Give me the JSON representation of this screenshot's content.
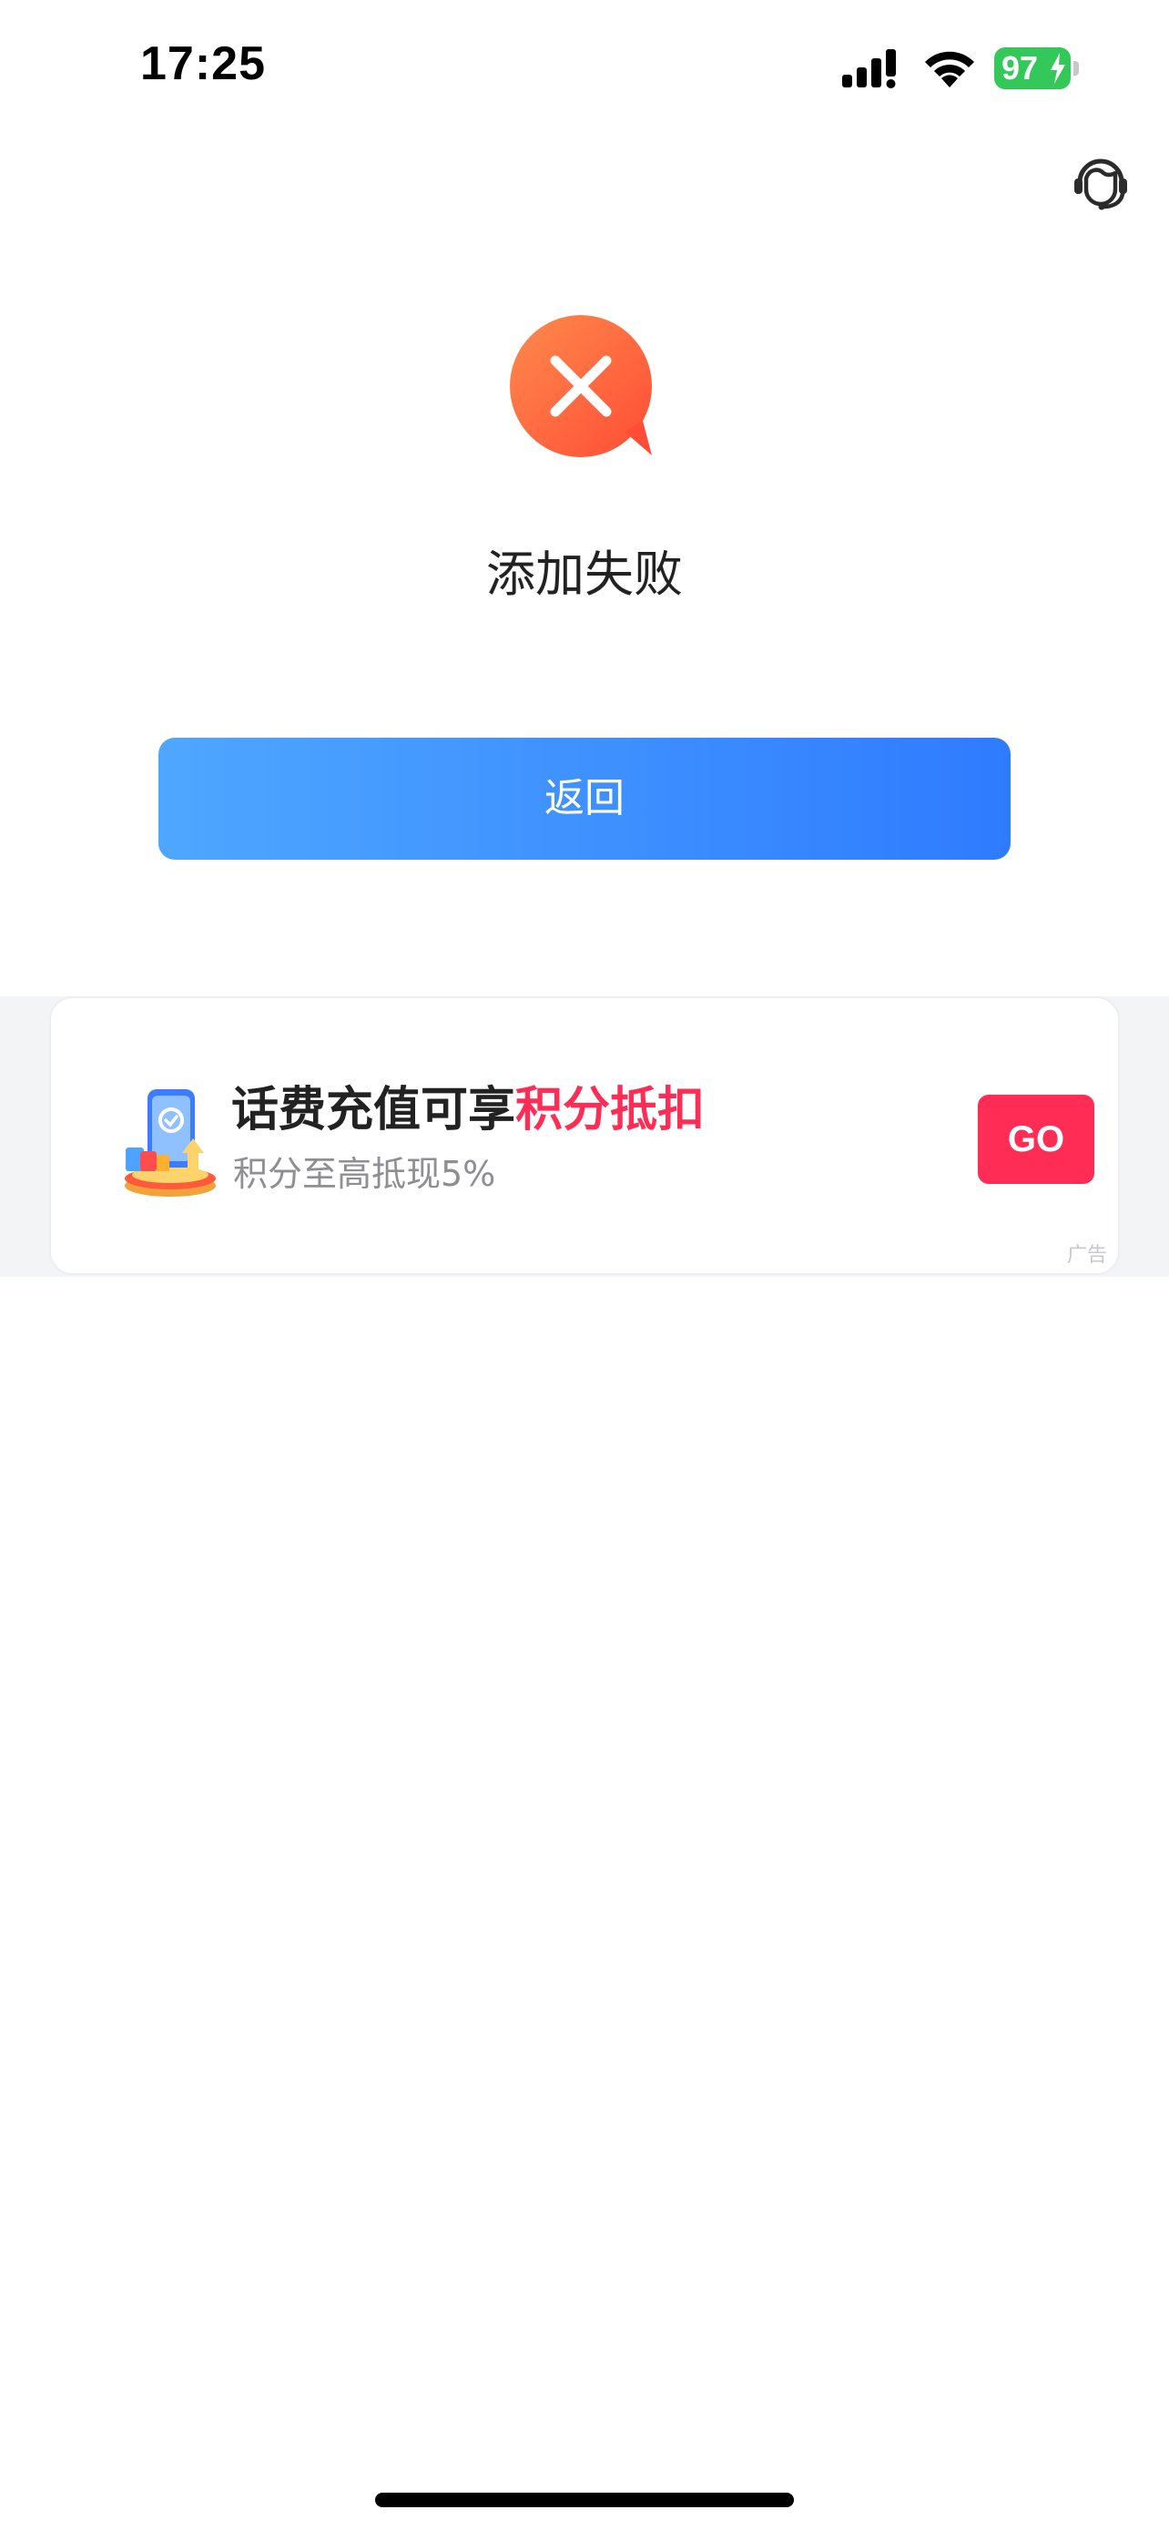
{
  "status_bar": {
    "time": "17:25",
    "battery_level": "97",
    "icons": [
      "signal-icon",
      "wifi-icon",
      "battery-icon",
      "charging-bolt-icon"
    ]
  },
  "header": {
    "service_icon": "customer-service-icon"
  },
  "result": {
    "icon": "error-x-icon",
    "title": "添加失败",
    "back_label": "返回"
  },
  "ad": {
    "image_icon": "phone-recharge-promo-icon",
    "title_prefix": "话费充值可享",
    "title_highlight": "积分抵扣",
    "subtitle": "积分至高抵现5%",
    "cta": "GO",
    "badge": "广告"
  },
  "colors": {
    "accent_blue_start": "#4fa7ff",
    "accent_blue_end": "#2f7bff",
    "promo_red": "#ff2d55",
    "error_orange": "#ff6a3d",
    "battery_green": "#34c759"
  }
}
